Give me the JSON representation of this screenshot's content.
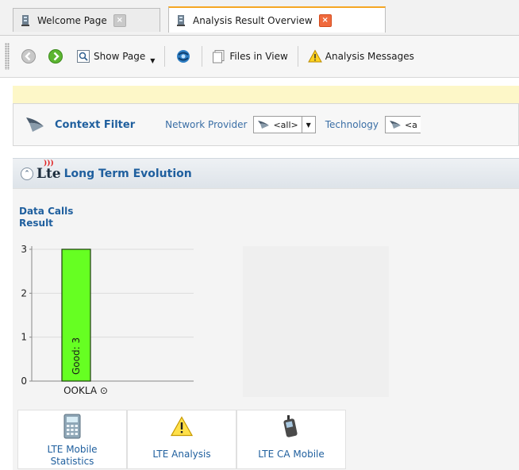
{
  "tabs": [
    {
      "label": "Welcome Page",
      "active": false
    },
    {
      "label": "Analysis Result Overview",
      "active": true
    }
  ],
  "toolbar": {
    "show_page_label": "Show Page",
    "files_in_view_label": "Files in View",
    "analysis_messages_label": "Analysis Messages"
  },
  "context_filter": {
    "title": "Context Filter",
    "network_provider_label": "Network Provider",
    "network_provider_value": "<all>",
    "technology_label": "Technology",
    "technology_value": "<a"
  },
  "panel": {
    "logo_text": "Lte",
    "title": "Long Term Evolution"
  },
  "chart_data": {
    "type": "bar",
    "title_line1": "Data Calls",
    "title_line2": "Result",
    "categories": [
      "OOKLA"
    ],
    "series": [
      {
        "name": "Good",
        "values": [
          3
        ]
      }
    ],
    "bar_label": "Good: 3",
    "yticks": [
      "0",
      "1",
      "2",
      "3"
    ],
    "ylim": [
      0,
      3
    ],
    "category_marker": "⊙",
    "grid": true,
    "bar_color": "#66ff22"
  },
  "tiles": [
    {
      "label_line1": "LTE Mobile",
      "label_line2": "Statistics",
      "icon": "calculator-icon"
    },
    {
      "label_line1": "LTE Analysis",
      "label_line2": "",
      "icon": "warning-icon"
    },
    {
      "label_line1": "LTE CA Mobile",
      "label_line2": "",
      "icon": "mobile-phone-icon"
    }
  ],
  "colors": {
    "accent": "#1f5f9e",
    "active_tab_border": "#f5a623",
    "message_bar": "#fdf7c8"
  }
}
